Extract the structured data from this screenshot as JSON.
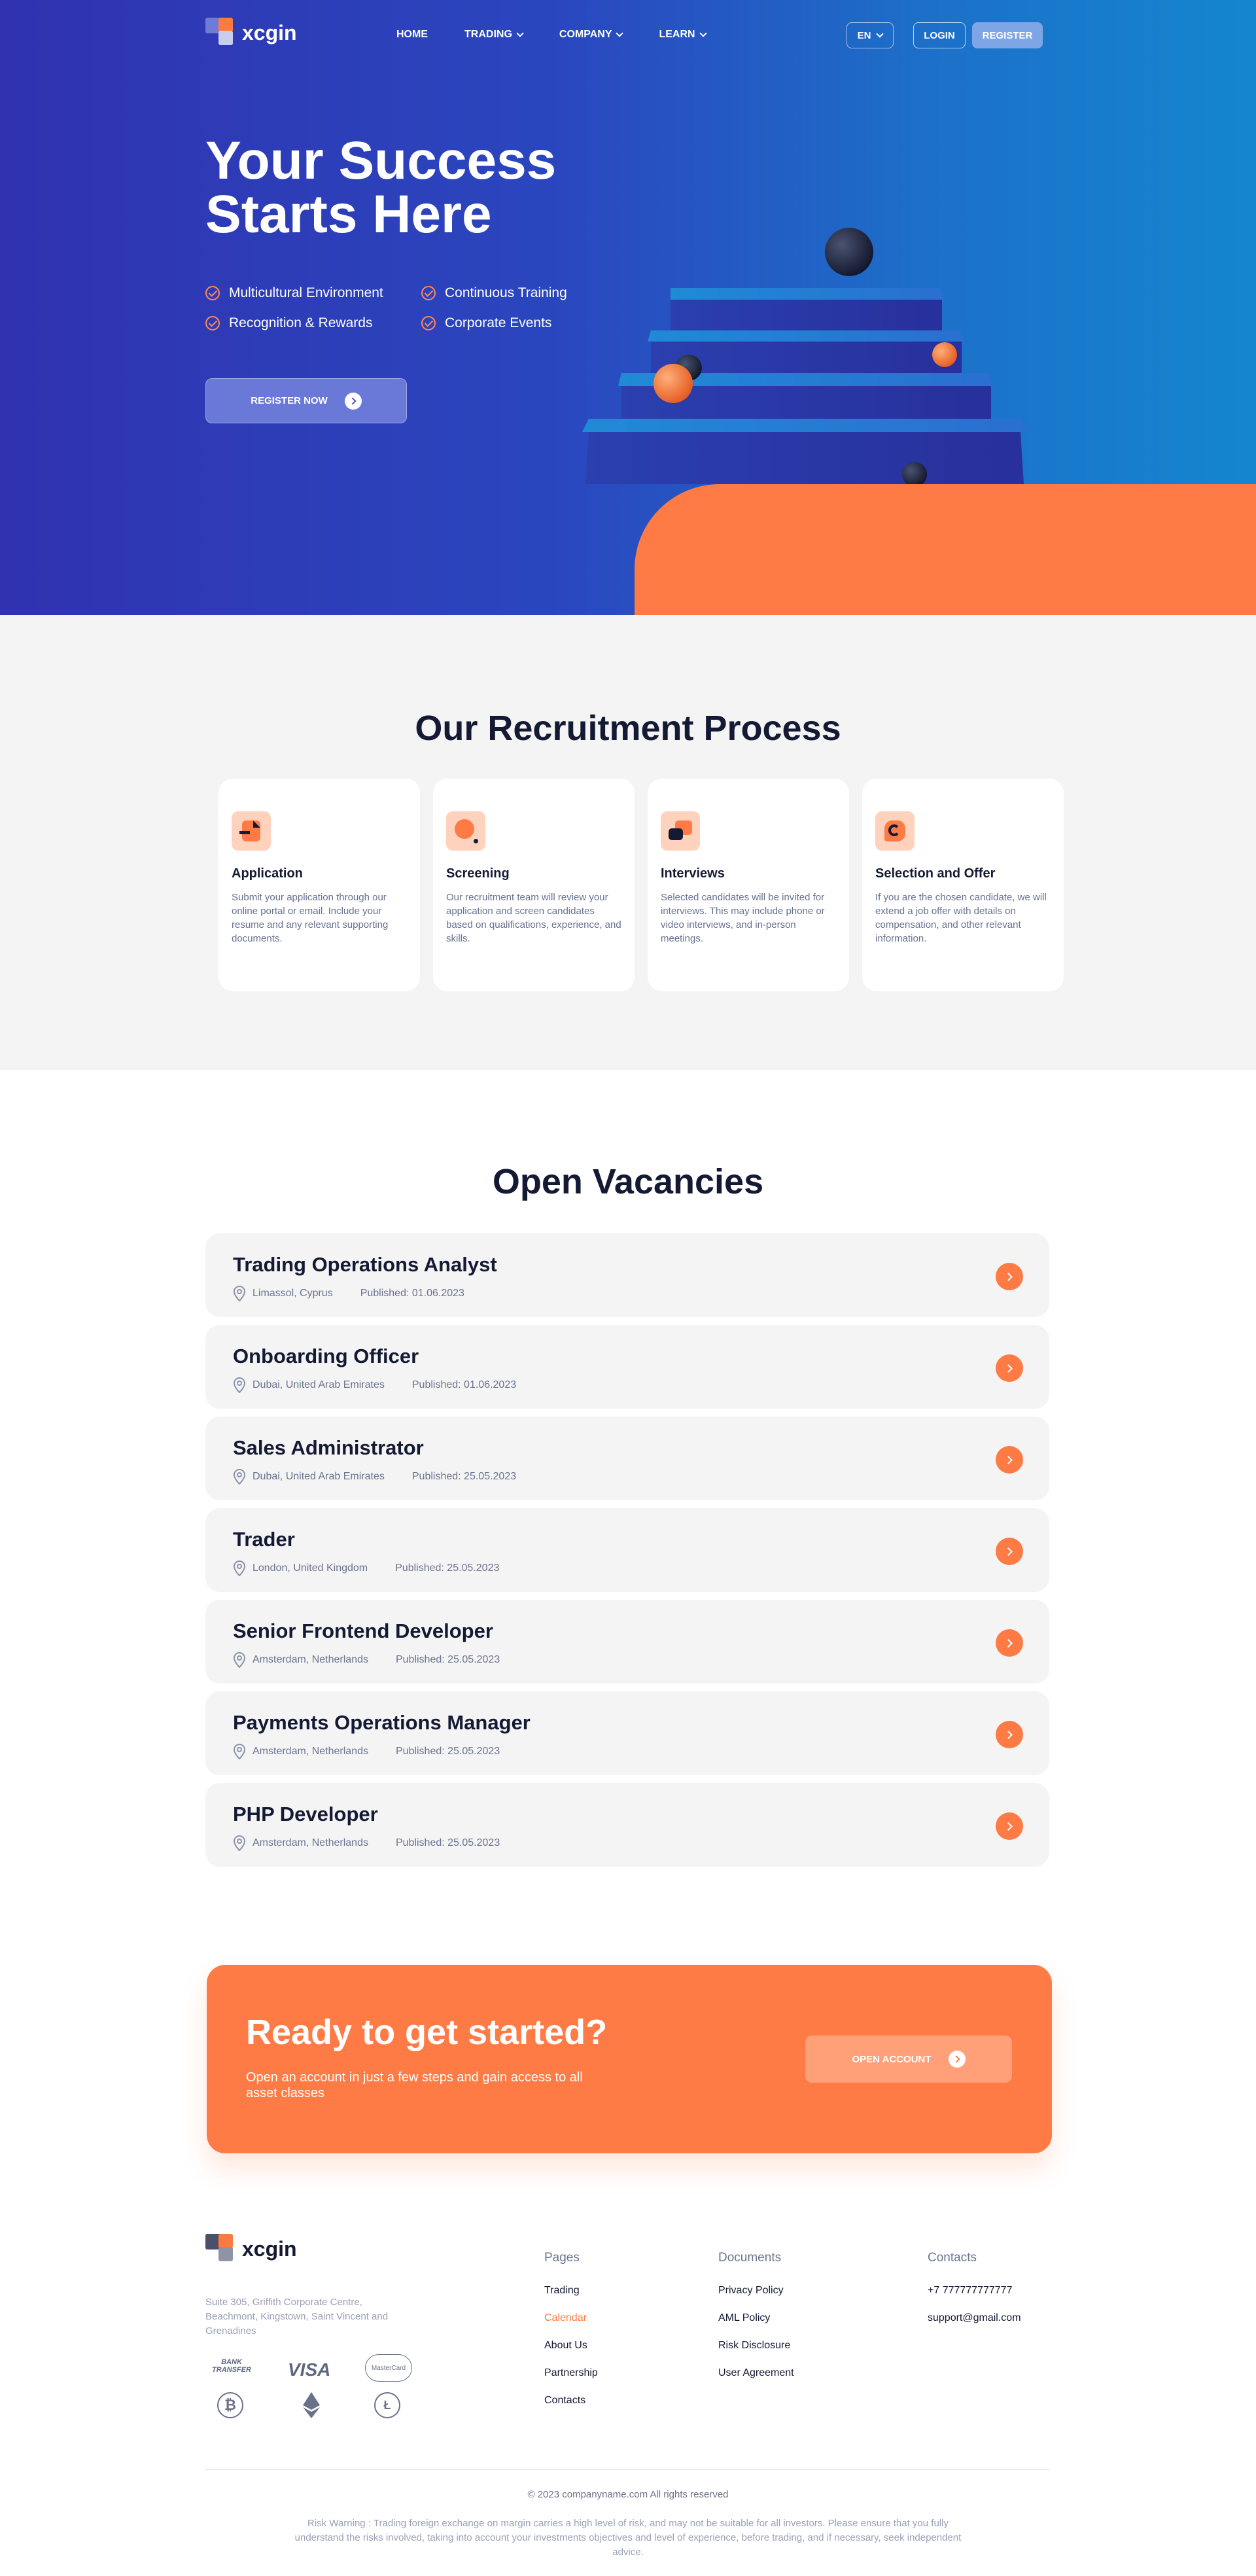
{
  "brand": {
    "name": "xcgin"
  },
  "nav": {
    "links": [
      "HOME",
      "TRADING",
      "COMPANY",
      "LEARN"
    ],
    "lang": "EN",
    "login": "LOGIN",
    "register": "REGISTER"
  },
  "hero": {
    "title_line1": "Your Success",
    "title_line2": "Starts Here",
    "features": [
      "Multicultural Environment",
      "Continuous Training",
      "Recognition & Rewards",
      "Corporate Events"
    ],
    "cta": "REGISTER NOW"
  },
  "process": {
    "title": "Our Recruitment Process",
    "steps": [
      {
        "title": "Application",
        "desc": "Submit your application through our online portal or email. Include your resume and any relevant supporting documents."
      },
      {
        "title": "Screening",
        "desc": "Our recruitment team will review your application and screen candidates based on qualifications, experience, and skills."
      },
      {
        "title": "Interviews",
        "desc": "Selected candidates will be invited for interviews. This may include phone or video interviews, and in-person meetings."
      },
      {
        "title": "Selection and Offer",
        "desc": "If you are the chosen candidate, we will extend a job offer with details on compensation, and other relevant information."
      }
    ]
  },
  "vacancies": {
    "title": "Open Vacancies",
    "items": [
      {
        "title": "Trading Operations Analyst",
        "location": "Limassol, Cyprus",
        "published": "Published: 01.06.2023"
      },
      {
        "title": "Onboarding Officer",
        "location": "Dubai, United Arab Emirates",
        "published": "Published: 01.06.2023"
      },
      {
        "title": "Sales Administrator",
        "location": "Dubai, United Arab Emirates",
        "published": "Published: 25.05.2023"
      },
      {
        "title": "Trader",
        "location": "London, United Kingdom",
        "published": "Published: 25.05.2023"
      },
      {
        "title": "Senior Frontend Developer",
        "location": "Amsterdam, Netherlands",
        "published": "Published: 25.05.2023"
      },
      {
        "title": "Payments Operations Manager",
        "location": "Amsterdam, Netherlands",
        "published": "Published: 25.05.2023"
      },
      {
        "title": "PHP Developer",
        "location": "Amsterdam, Netherlands",
        "published": "Published: 25.05.2023"
      }
    ]
  },
  "ready": {
    "title": "Ready to get started?",
    "subtitle": "Open an account in just a few steps and gain access to all asset classes",
    "button": "OPEN ACCOUNT"
  },
  "footer": {
    "address": "Suite 305, Griffith Corporate Centre, Beachmont, Kingstown, Saint Vincent and Grenadines",
    "payments": [
      "BANK TRANSFER",
      "VISA",
      "MasterCard"
    ],
    "pages": {
      "title": "Pages",
      "links": [
        "Trading",
        "Calendar",
        "About Us",
        "Partnership",
        "Contacts"
      ]
    },
    "documents": {
      "title": "Documents",
      "links": [
        "Privacy Policy",
        "AML Policy",
        "Risk Disclosure",
        "User Agreement"
      ]
    },
    "contacts": {
      "title": "Contacts",
      "links": [
        "+7 777777777777",
        "support@gmail.com"
      ]
    },
    "copyright": "© 2023 companyname.com All rights reserved",
    "risk": "Risk Warning : Trading foreign exchange on margin carries a high level of risk, and may not be suitable for all investors. Please ensure that you fully understand the risks involved, taking into account your investments objectives and level of experience, before trading, and if necessary, seek independent advice."
  },
  "colors": {
    "accent": "#ff7b45",
    "hero_start": "#3032b0",
    "hero_end": "#1486cf",
    "dark_text": "#141a33"
  }
}
